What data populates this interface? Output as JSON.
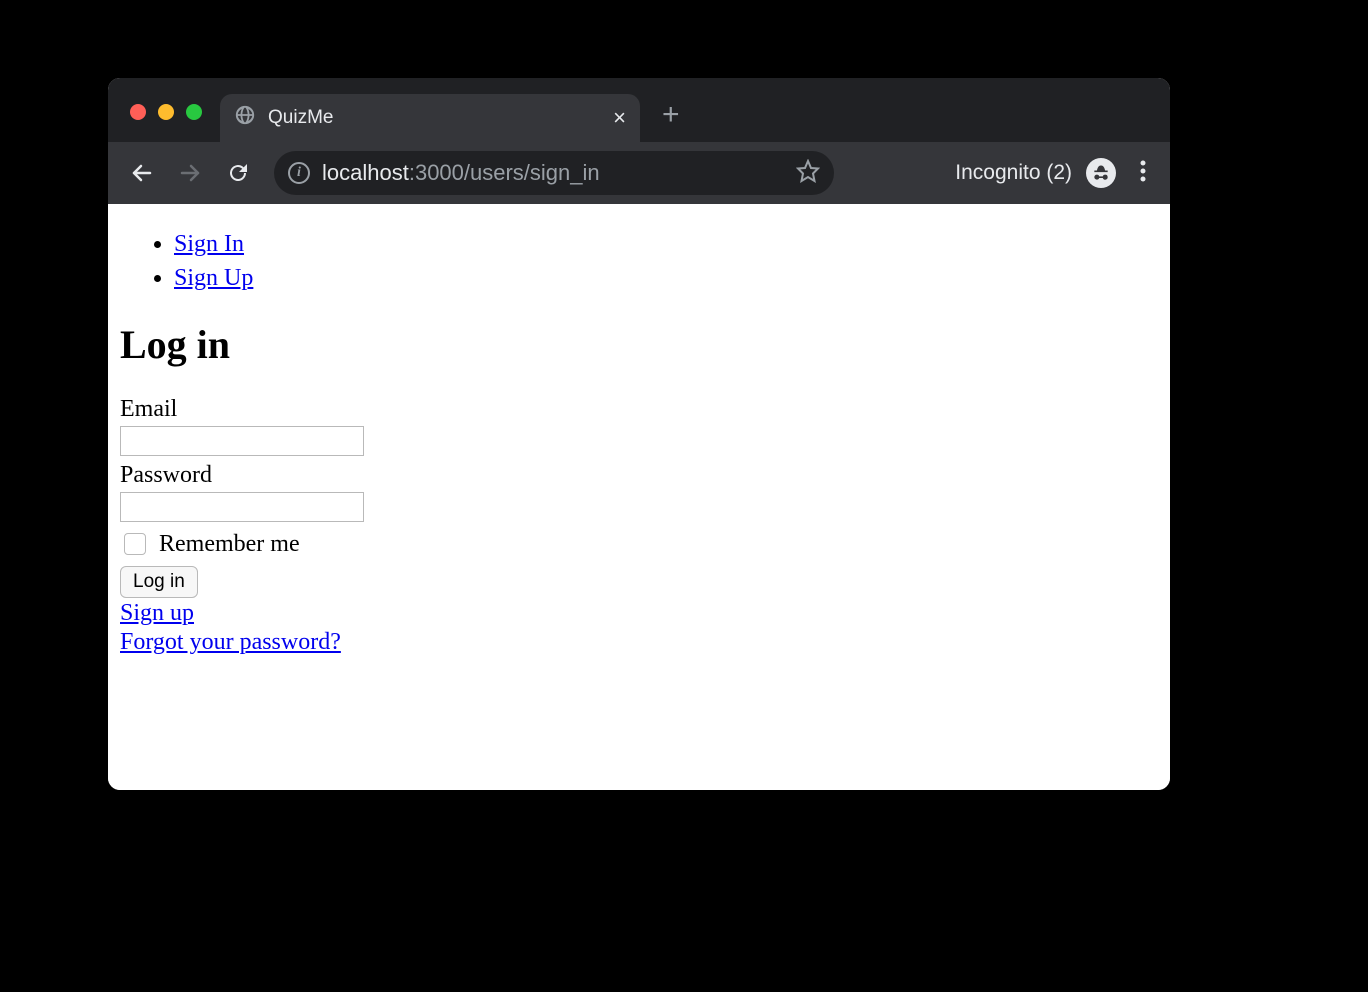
{
  "browser": {
    "tab_title": "QuizMe",
    "url_host": "localhost",
    "url_path": ":3000/users/sign_in",
    "incognito_label": "Incognito (2)"
  },
  "nav": {
    "links": [
      "Sign In",
      "Sign Up"
    ]
  },
  "page": {
    "heading": "Log in",
    "email_label": "Email",
    "password_label": "Password",
    "remember_label": "Remember me",
    "submit_label": "Log in",
    "signup_link": "Sign up",
    "forgot_link": "Forgot your password?"
  }
}
